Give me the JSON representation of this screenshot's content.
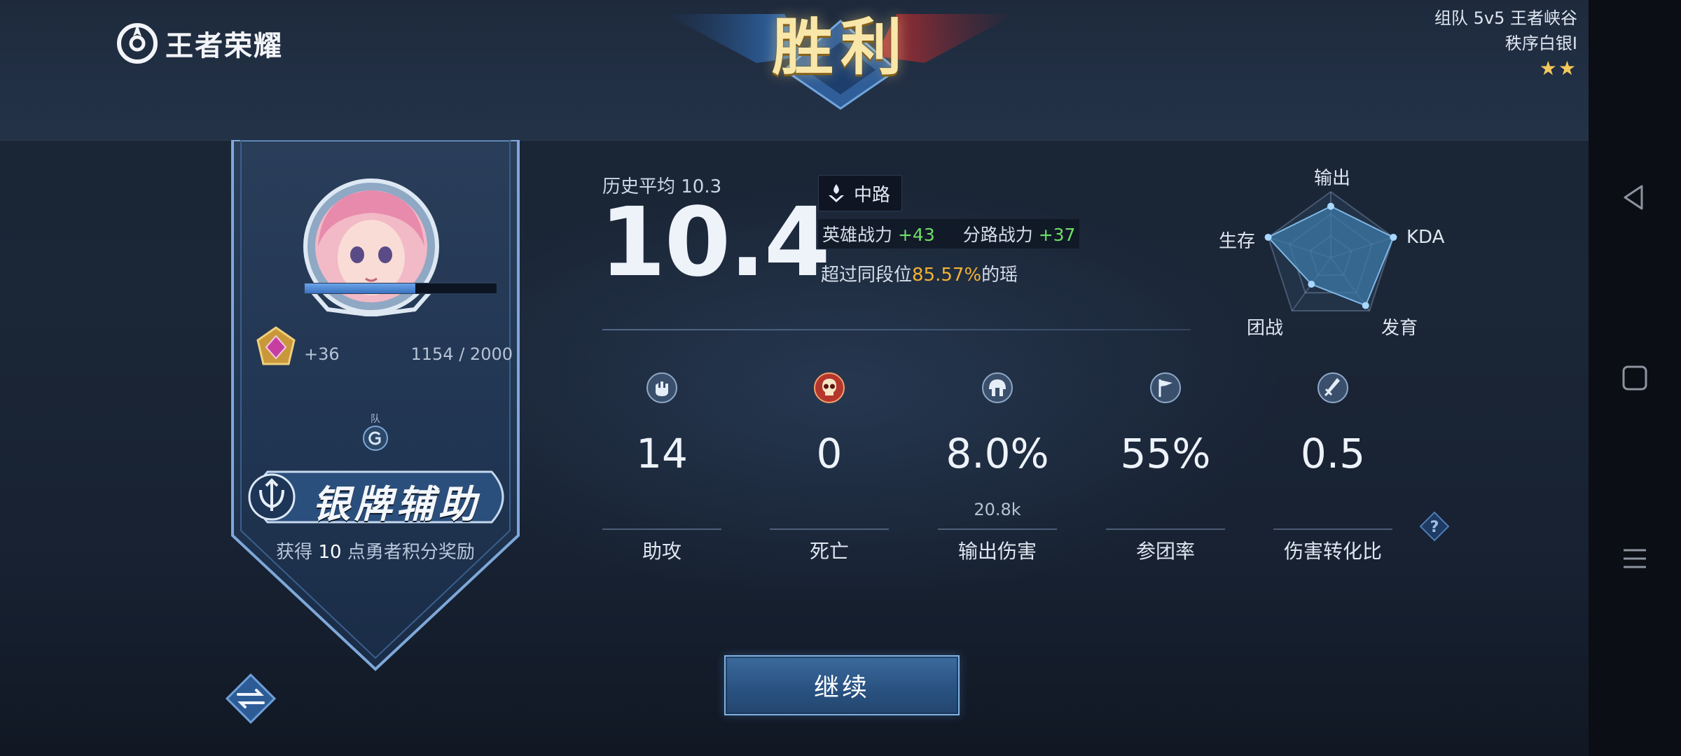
{
  "logo": {
    "text": "王者荣耀"
  },
  "banner": {
    "title": "胜利"
  },
  "mode": {
    "line1": "组队 5v5 王者峡谷",
    "line2": "秩序白银I",
    "stars": "★★",
    "star_count": 2
  },
  "profile": {
    "xp_gain": "+36",
    "xp_text": "1154 / 2000",
    "xp_fraction": 0.577,
    "team_mark": "队",
    "badge_title": "银牌辅助",
    "reward_prefix": "获得",
    "reward_value": "10",
    "reward_suffix": "点勇者积分奖励"
  },
  "score": {
    "history_label": "历史平均 10.3",
    "value": "10.4",
    "lane": "中路",
    "hero_power_label": "英雄战力",
    "hero_power_value": "+43",
    "lane_power_label": "分路战力",
    "lane_power_value": "+37",
    "exceed_prefix": "超过同段位",
    "exceed_percent": "85.57%",
    "exceed_suffix": "的瑶"
  },
  "radar": {
    "axes": [
      "输出",
      "KDA",
      "发育",
      "团战",
      "生存"
    ],
    "values": [
      0.78,
      1.0,
      0.9,
      0.5,
      1.0
    ]
  },
  "stats": [
    {
      "label": "助攻",
      "value": "14",
      "sub": "",
      "icon": "fist-icon"
    },
    {
      "label": "死亡",
      "value": "0",
      "sub": "",
      "icon": "skull-icon"
    },
    {
      "label": "输出伤害",
      "value": "8.0%",
      "sub": "20.8k",
      "icon": "helmet-icon"
    },
    {
      "label": "参团率",
      "value": "55%",
      "sub": "",
      "icon": "flag-icon"
    },
    {
      "label": "伤害转化比",
      "value": "0.5",
      "sub": "",
      "icon": "sword-icon"
    }
  ],
  "buttons": {
    "continue": "继续"
  },
  "colors": {
    "accent_gold": "#f2b233",
    "positive_green": "#6fe06a",
    "radar_fill": "#3d7aa6",
    "button_blue": "#2a5382"
  }
}
